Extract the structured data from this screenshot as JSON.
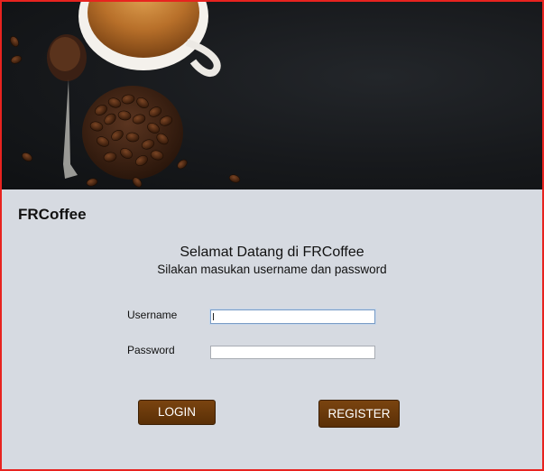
{
  "app": {
    "brand": "FRCoffee"
  },
  "greeting": {
    "welcome": "Selamat Datang di FRCoffee",
    "instruction": "Silakan masukan username dan password"
  },
  "form": {
    "username_label": "Username",
    "username_value": "",
    "password_label": "Password",
    "password_value": ""
  },
  "buttons": {
    "login": "LOGIN",
    "register": "REGISTER"
  },
  "colors": {
    "window_border": "#e8231f",
    "panel_background": "#d6dae1",
    "button": "#6a3a0b",
    "button_text": "#ffffff"
  },
  "banner": {
    "icon": "coffee-banner-image"
  }
}
